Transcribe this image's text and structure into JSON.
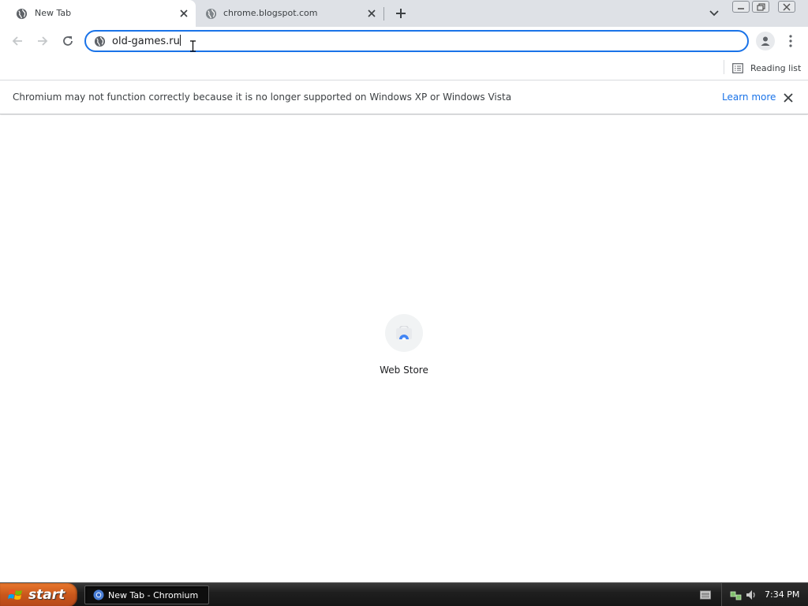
{
  "tabs": [
    {
      "title": "New Tab",
      "active": true
    },
    {
      "title": "chrome.blogspot.com",
      "active": false
    }
  ],
  "toolbar": {
    "url": "old-games.ru"
  },
  "bookmarks": {
    "reading_list_label": "Reading list"
  },
  "infobar": {
    "message": "Chromium may not function correctly because it is no longer supported on Windows XP or Windows Vista",
    "learn_more": "Learn more"
  },
  "content": {
    "shortcut_label": "Web Store"
  },
  "taskbar": {
    "start_label": "start",
    "task_label": "New Tab - Chromium",
    "clock": "7:34 PM"
  },
  "icons": {
    "tab_favicon": "globe-icon",
    "new_tab": "plus-icon",
    "tab_search": "chevron-down-icon",
    "back": "arrow-left-icon",
    "forward": "arrow-right-icon",
    "reload": "reload-icon",
    "profile": "person-icon",
    "menu": "kebab-icon",
    "reading_list": "list-icon",
    "web_store": "web-store-icon"
  },
  "colors": {
    "accent": "#1a73e8",
    "tabstrip": "#dee1e6",
    "start_button": "#c9571b"
  }
}
